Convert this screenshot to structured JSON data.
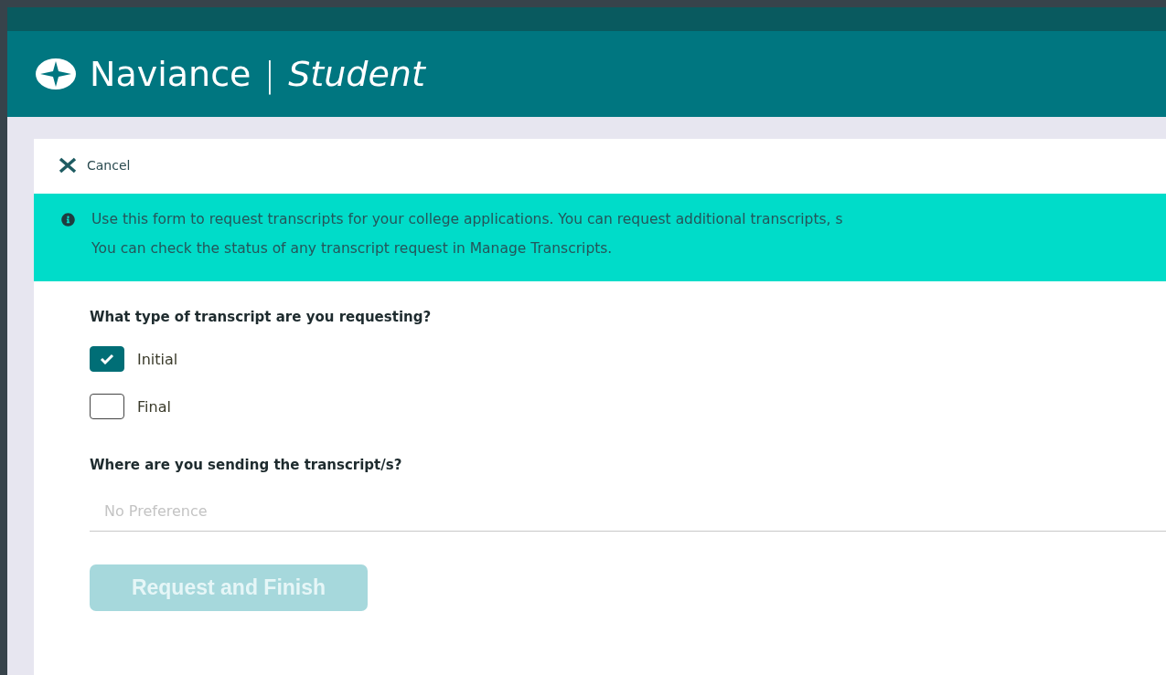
{
  "header": {
    "brand": "Naviance",
    "separator": "|",
    "product": "Student"
  },
  "cancel": {
    "label": "Cancel"
  },
  "info_banner": {
    "lines": [
      "Use this form to request transcripts for your college applications. You can request additional transcripts, s",
      "You can check the status of any transcript request in Manage Transcripts."
    ]
  },
  "transcript_type": {
    "question": "What type of transcript are you requesting?",
    "options": [
      {
        "label": "Initial",
        "checked": true
      },
      {
        "label": "Final",
        "checked": false
      }
    ]
  },
  "destination": {
    "question": "Where are you sending the transcript/s?",
    "placeholder": "No Preference"
  },
  "submit": {
    "label": "Request and Finish",
    "disabled": true
  }
}
